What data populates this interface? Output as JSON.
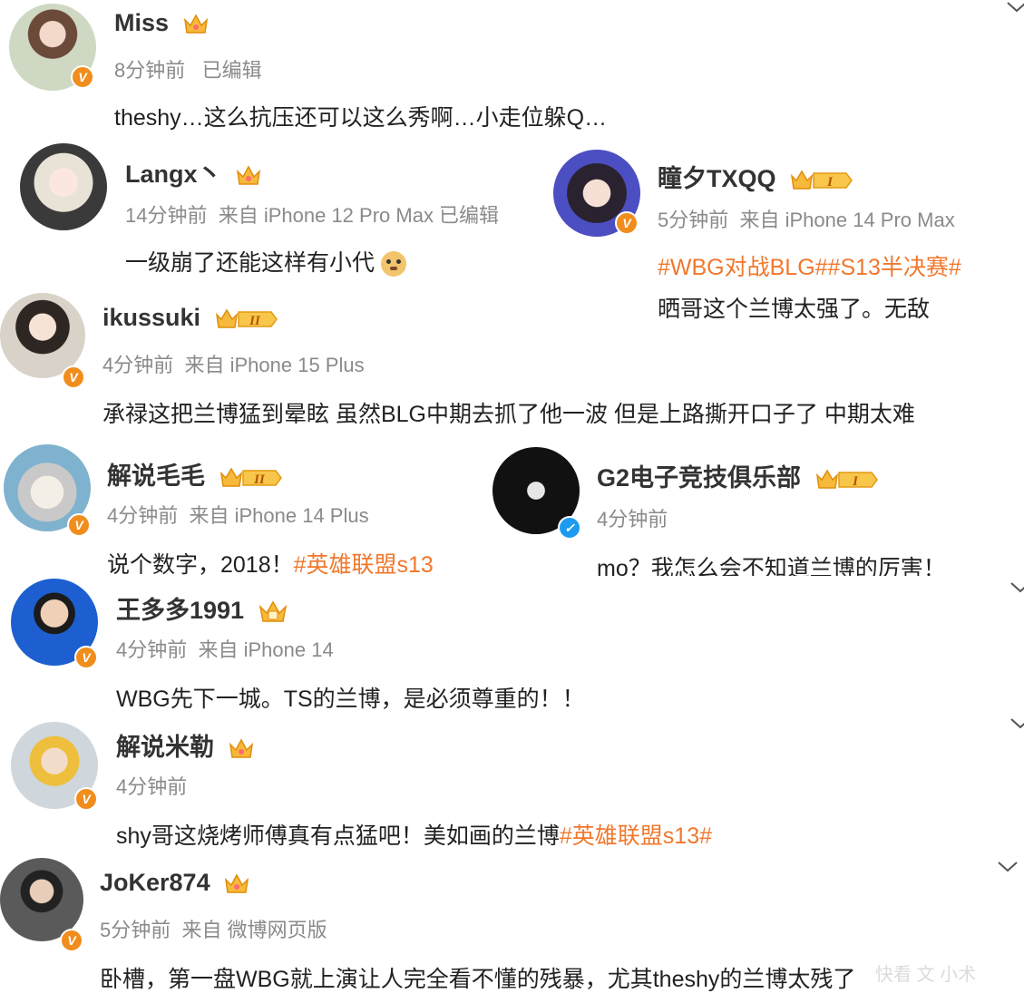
{
  "colors": {
    "tag": "#f0782d",
    "verified_orange": "#f08d1c",
    "verified_blue": "#1d9bf0",
    "meta_gray": "#8a8a8a",
    "crown_gold": "#f6b93b"
  },
  "comments": [
    {
      "name": "Miss",
      "time": "8分钟前",
      "source": "已编辑",
      "text": "theshy…这么抗压还可以这么秀啊…小走位躲Q…",
      "level": ""
    },
    {
      "name": "Langx丶",
      "time": "14分钟前",
      "source": "来自 iPhone 12 Pro Max 已编辑",
      "text": "一级崩了还能这样有小代",
      "level": ""
    },
    {
      "name": "瞳夕TXQQ",
      "time": "5分钟前",
      "source": "来自 iPhone 14 Pro Max",
      "tags": "#WBG对战BLG##S13半决赛#",
      "text": "晒哥这个兰博太强了。无敌",
      "level": "I"
    },
    {
      "name": "ikussuki",
      "time": "4分钟前",
      "source": "来自 iPhone 15 Plus",
      "text": "承禄这把兰博猛到晕眩 虽然BLG中期去抓了他一波 但是上路撕开口子了 中期太难",
      "level": "II"
    },
    {
      "name": "解说毛毛",
      "time": "4分钟前",
      "source": "来自 iPhone 14 Plus",
      "text": "说个数字，2018！",
      "tag": "#英雄联盟s13",
      "level": "II"
    },
    {
      "name": "G2电子竞技俱乐部",
      "time": "4分钟前",
      "source": "",
      "text": "mo？我怎么会不知道兰博的厉害！",
      "level": "I"
    },
    {
      "name": "王多多1991",
      "time": "4分钟前",
      "source": "来自 iPhone 14",
      "text": "WBG先下一城。TS的兰博，是必须尊重的！！",
      "level": ""
    },
    {
      "name": "解说米勒",
      "time": "4分钟前",
      "source": "",
      "text": "shy哥这烧烤师傅真有点猛吧！美如画的兰博",
      "tag": "#英雄联盟s13#",
      "level": ""
    },
    {
      "name": "JoKer874",
      "time": "5分钟前",
      "source": "来自 微博网页版",
      "text": "卧槽，第一盘WBG就上演让人完全看不懂的残暴，尤其theshy的兰博太残了",
      "level": ""
    }
  ],
  "watermark": "快看 文 小术",
  "icons": {
    "verified": "verified-v-icon",
    "crown": "crown-icon",
    "more": "chevron-down-icon"
  }
}
